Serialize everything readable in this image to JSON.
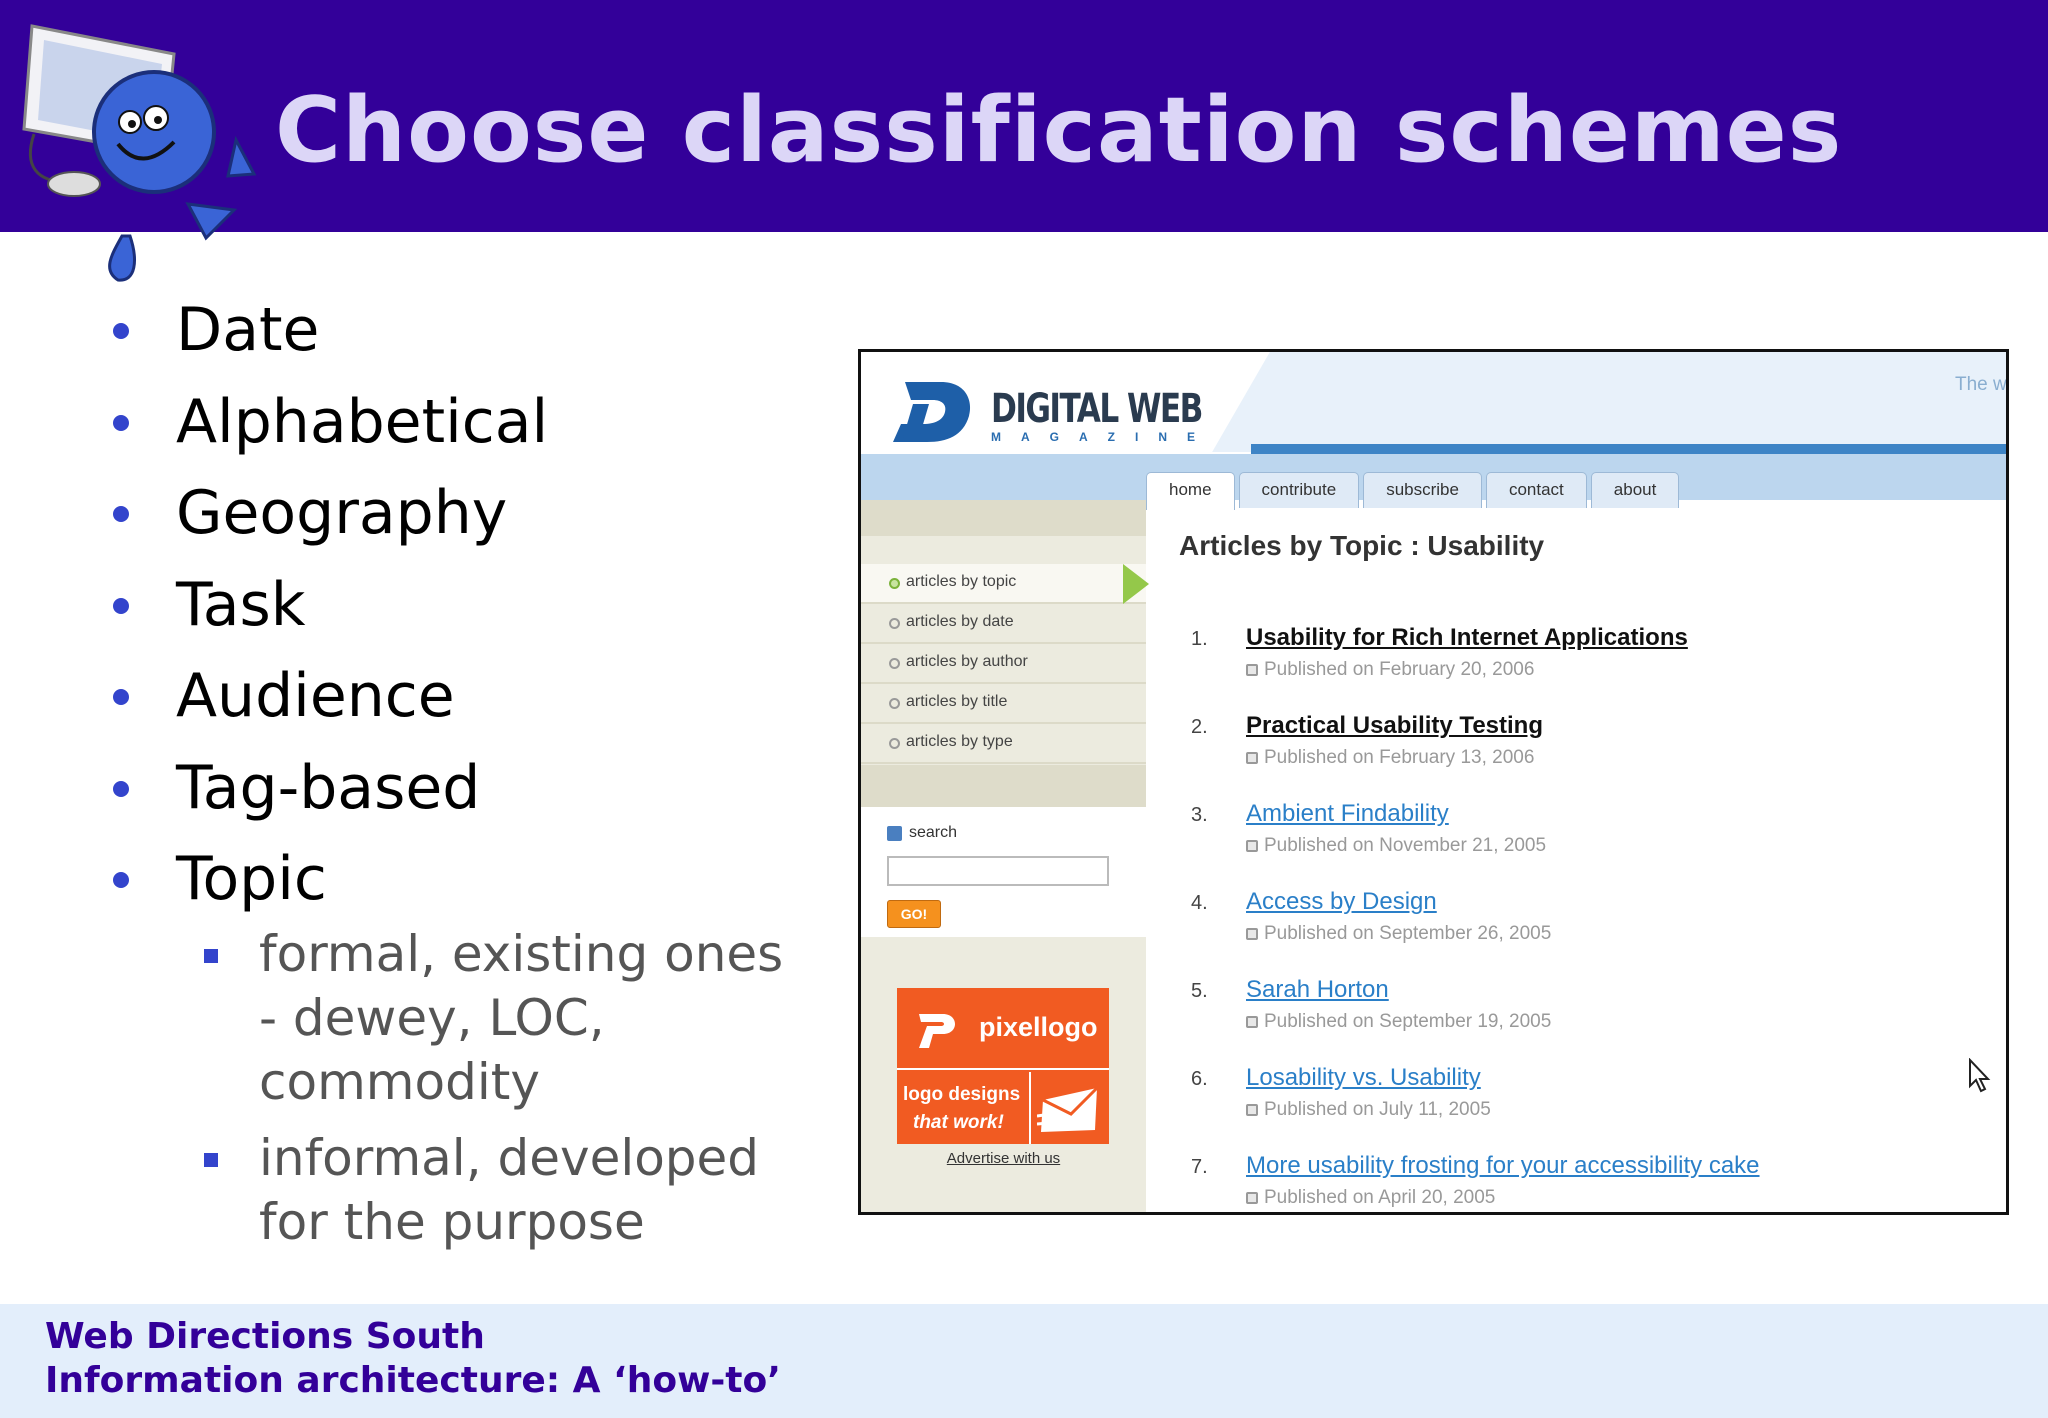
{
  "slide": {
    "title": "Choose classification schemes",
    "bullets": [
      "Date",
      "Alphabetical",
      "Geography",
      "Task",
      "Audience",
      "Tag-based",
      "Topic"
    ],
    "sub_bullets": [
      "formal, existing ones - dewey, LOC, commodity",
      "informal, developed for the purpose"
    ],
    "footer": {
      "line1": "Web Directions South",
      "line2": "Information architecture: A ‘how-to’"
    }
  },
  "screenshot": {
    "tagline": "The w",
    "logo": {
      "name": "DIGITAL WEB",
      "sub": "MAGAZINE"
    },
    "tabs": [
      "home",
      "contribute",
      "subscribe",
      "contact",
      "about"
    ],
    "sidebar": {
      "items": [
        "articles by topic",
        "articles by date",
        "articles by author",
        "articles by title",
        "articles by type"
      ],
      "search_label": "search",
      "go_label": "GO!",
      "ad": {
        "brand": "pixellogo",
        "line1": "logo designs",
        "line2": "that work!"
      },
      "advertise_link": "Advertise with us"
    },
    "heading": "Articles by Topic : Usability",
    "articles": [
      {
        "num": "1.",
        "title": "Usability for Rich Internet Applications",
        "published": "Published on February 20, 2006"
      },
      {
        "num": "2.",
        "title": "Practical Usability Testing",
        "published": "Published on February 13, 2006"
      },
      {
        "num": "3.",
        "title": "Ambient Findability",
        "published": "Published on November 21, 2005"
      },
      {
        "num": "4.",
        "title": "Access by Design",
        "published": "Published on September 26, 2005"
      },
      {
        "num": "5.",
        "title": "Sarah Horton",
        "published": "Published on September 19, 2005"
      },
      {
        "num": "6.",
        "title": "Losability vs. Usability",
        "published": "Published on July 11, 2005"
      },
      {
        "num": "7.",
        "title": "More usability frosting for your accessibility cake",
        "published": "Published on April 20, 2005"
      }
    ]
  },
  "colors": {
    "header_bg": "#330099",
    "title_text": "#dcd6f7",
    "bullet_marker": "#3344cc",
    "footer_bg": "#e3eefb",
    "footer_text": "#330099",
    "link_blue": "#2a7fc8",
    "ad_orange": "#f15b22"
  }
}
